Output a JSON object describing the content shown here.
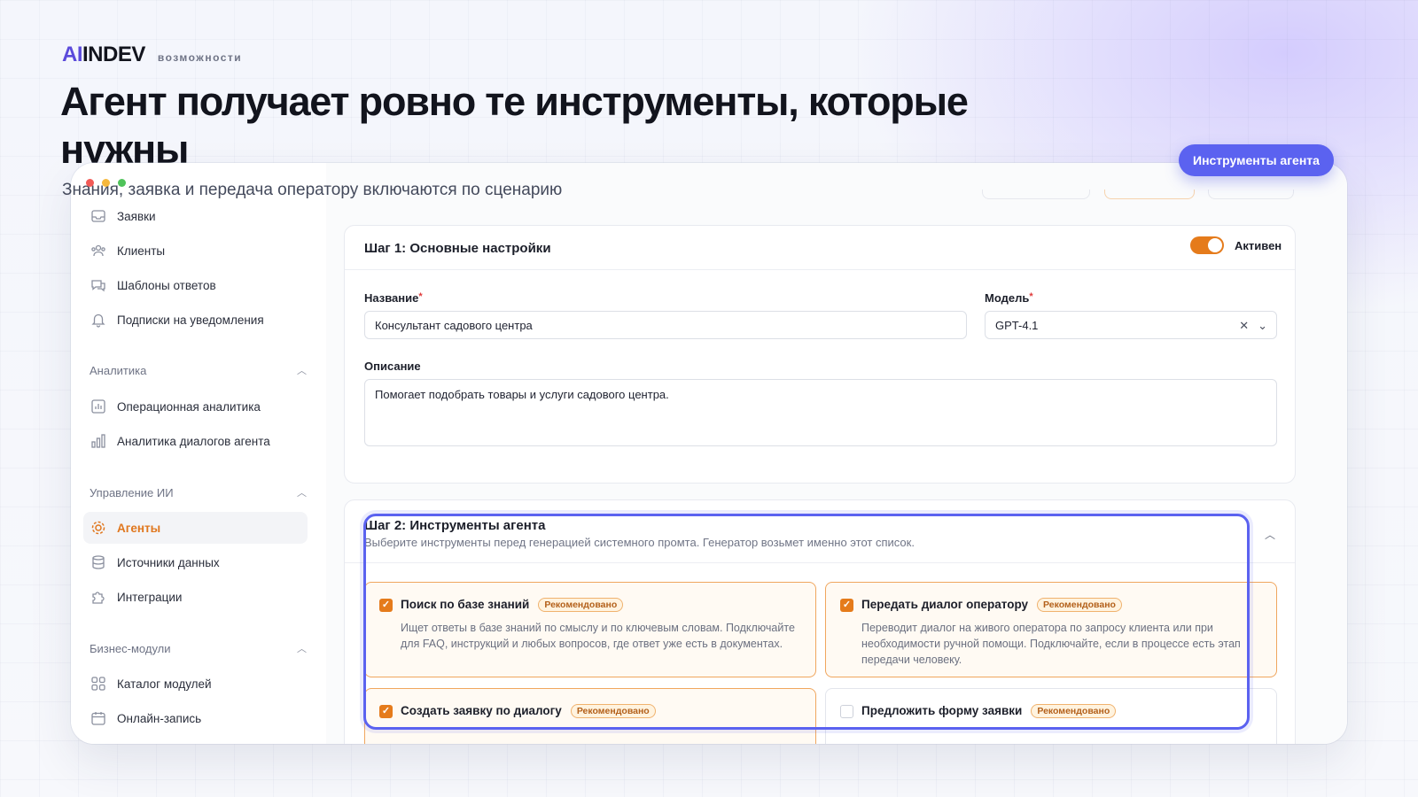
{
  "brand": {
    "logo_ai": "AI",
    "logo_rest": "INDEV",
    "tag": "возможности"
  },
  "headline": "Агент получает ровно те инструменты, которые нужны",
  "subline": "Знания, заявка и передача оператору включаются по сценарию",
  "pill_label": "Инструменты агента",
  "window_dots": [
    "#f25b57",
    "#f6b83c",
    "#4fc35a"
  ],
  "sidebar": {
    "items_top": [
      {
        "label": "Заявки",
        "icon": "inbox-icon"
      },
      {
        "label": "Клиенты",
        "icon": "users-icon"
      },
      {
        "label": "Шаблоны ответов",
        "icon": "chat-icon"
      },
      {
        "label": "Подписки на уведомления",
        "icon": "bell-icon"
      }
    ],
    "section_analytics": "Аналитика",
    "items_analytics": [
      {
        "label": "Операционная аналитика",
        "icon": "chart-icon"
      },
      {
        "label": "Аналитика диалогов агента",
        "icon": "bar-chart-icon"
      }
    ],
    "section_ai": "Управление ИИ",
    "items_ai": [
      {
        "label": "Агенты",
        "icon": "agent-gear-icon",
        "active": true
      },
      {
        "label": "Источники данных",
        "icon": "database-icon"
      },
      {
        "label": "Интеграции",
        "icon": "puzzle-icon"
      }
    ],
    "section_business": "Бизнес-модули",
    "items_business": [
      {
        "label": "Каталог модулей",
        "icon": "grid-icon"
      },
      {
        "label": "Онлайн-запись",
        "icon": "calendar-icon"
      }
    ]
  },
  "step1": {
    "title": "Шаг 1: Основные настройки",
    "toggle_label": "Активен",
    "toggle_on": true,
    "name_label": "Название",
    "name_value": "Консультант садового центра",
    "model_label": "Модель",
    "model_value": "GPT-4.1",
    "desc_label": "Описание",
    "desc_value": "Помогает подобрать товары и услуги садового центра."
  },
  "step2": {
    "title": "Шаг 2: Инструменты агента",
    "subtitle": "Выберите инструменты перед генерацией системного промта. Генератор возьмет именно этот список.",
    "badge": "Рекомендовано",
    "tools": [
      {
        "title": "Поиск по базе знаний",
        "checked": true,
        "desc": "Ищет ответы в базе знаний по смыслу и по ключевым словам. Подключайте для FAQ, инструкций и любых вопросов, где ответ уже есть в документах."
      },
      {
        "title": "Передать диалог оператору",
        "checked": true,
        "desc": "Переводит диалог на живого оператора по запросу клиента или при необходимости ручной помощи. Подключайте, если в процессе есть этап передачи человеку."
      },
      {
        "title": "Создать заявку по диалогу",
        "checked": true,
        "desc": ""
      },
      {
        "title": "Предложить форму заявки",
        "checked": false,
        "desc": ""
      }
    ]
  },
  "colors": {
    "accent": "#e57b1b",
    "highlight": "#5b62f0"
  }
}
